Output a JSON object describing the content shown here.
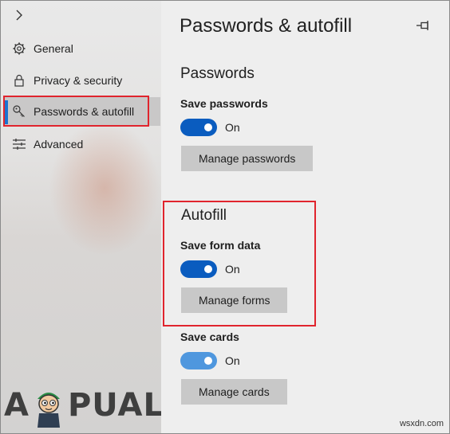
{
  "sidebar": {
    "items": [
      {
        "label": "General",
        "icon": "gear-icon"
      },
      {
        "label": "Privacy & security",
        "icon": "lock-icon"
      },
      {
        "label": "Passwords & autofill",
        "icon": "key-icon",
        "active": true
      },
      {
        "label": "Advanced",
        "icon": "sliders-icon"
      }
    ]
  },
  "main": {
    "title": "Passwords & autofill",
    "passwords": {
      "heading": "Passwords",
      "save_label": "Save passwords",
      "save_state": "On",
      "manage_button": "Manage passwords"
    },
    "autofill": {
      "heading": "Autofill",
      "form_label": "Save form data",
      "form_state": "On",
      "manage_forms_button": "Manage forms",
      "cards_label": "Save cards",
      "cards_state": "On",
      "manage_cards_button": "Manage cards"
    }
  },
  "watermark": {
    "left": "A",
    "right": "PUALS"
  },
  "source": "wsxdn.com",
  "colors": {
    "accent": "#0a5cbf",
    "highlight": "#e0242d"
  }
}
